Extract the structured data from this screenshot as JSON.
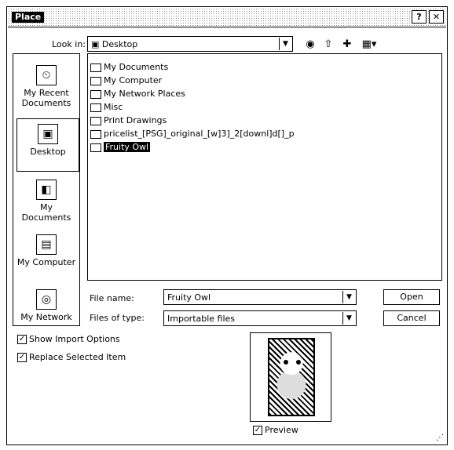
{
  "window": {
    "title": "Place"
  },
  "titlebar_buttons": [
    {
      "name": "help-button",
      "glyph": "?"
    },
    {
      "name": "close-button",
      "glyph": "✕"
    }
  ],
  "lookin": {
    "label": "Look in:",
    "value": "Desktop"
  },
  "toolbar_icons": [
    "back-icon",
    "up-folder-icon",
    "new-folder-icon",
    "view-menu-icon"
  ],
  "places": [
    {
      "label": "My Recent Documents",
      "icon": "recent-documents-icon",
      "glyph": "⏲",
      "selected": false
    },
    {
      "label": "Desktop",
      "icon": "desktop-icon",
      "glyph": "🖥",
      "selected": true
    },
    {
      "label": "My Documents",
      "icon": "my-documents-icon",
      "glyph": "📁",
      "selected": false
    },
    {
      "label": "My Computer",
      "icon": "my-computer-icon",
      "glyph": "💻",
      "selected": false
    },
    {
      "label": "My Network",
      "icon": "my-network-icon",
      "glyph": "🌐",
      "selected": false
    }
  ],
  "files": [
    {
      "name": "My Documents",
      "icon": "folder-icon",
      "selected": false
    },
    {
      "name": "My Computer",
      "icon": "computer-icon",
      "selected": false
    },
    {
      "name": "My Network Places",
      "icon": "network-icon",
      "selected": false
    },
    {
      "name": "Misc",
      "icon": "folder-icon",
      "selected": false
    },
    {
      "name": "Print Drawings",
      "icon": "folder-icon",
      "selected": false
    },
    {
      "name": "pricelist_[PSG]_original_[w]3]_2[downl]d[]_p",
      "icon": "file-icon",
      "selected": false
    },
    {
      "name": "Fruity Owl",
      "icon": "image-file-icon",
      "selected": true
    }
  ],
  "filename": {
    "label": "File name:",
    "value": "Fruity Owl"
  },
  "filetype": {
    "label": "Files of type:",
    "value": "Importable files"
  },
  "buttons": {
    "open": "Open",
    "cancel": "Cancel"
  },
  "options": {
    "show_import": {
      "label": "Show Import Options",
      "checked": true
    },
    "replace_selected": {
      "label": "Replace Selected Item",
      "checked": true
    },
    "preview": {
      "label": "Preview",
      "checked": true
    }
  },
  "preview_image": {
    "description": "owl illustration thumbnail"
  }
}
